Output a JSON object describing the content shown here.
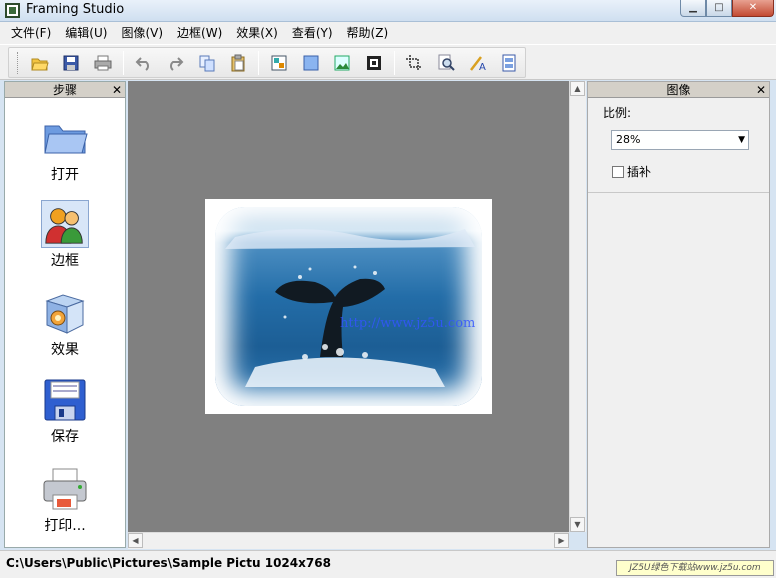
{
  "window": {
    "title": "Framing Studio"
  },
  "menu": [
    "文件(F)",
    "编辑(U)",
    "图像(V)",
    "边框(W)",
    "效果(X)",
    "查看(Y)",
    "帮助(Z)"
  ],
  "toolbar": {
    "icons": [
      "open-folder-icon",
      "save-icon",
      "print-icon",
      "undo-icon",
      "redo-icon",
      "copy-icon",
      "paste-icon",
      "image-adjust-icon",
      "frame-fill-icon",
      "picture-icon",
      "frame-border-icon",
      "crop-icon",
      "zoom-icon",
      "text-icon",
      "layout-icon"
    ]
  },
  "steps_panel": {
    "title": "步骤",
    "items": [
      {
        "label": "打开",
        "icon": "folder-icon"
      },
      {
        "label": "边框",
        "icon": "frame-people-icon"
      },
      {
        "label": "效果",
        "icon": "effects-box-icon"
      },
      {
        "label": "保存",
        "icon": "floppy-save-icon"
      },
      {
        "label": "打印...",
        "icon": "printer-icon"
      }
    ]
  },
  "canvas": {
    "watermark": "http://www.jz5u.com"
  },
  "image_panel": {
    "title": "图像",
    "scale_label": "比例:",
    "scale_value": "28%",
    "interpolate_label": "插补"
  },
  "status": {
    "text": "C:\\Users\\Public\\Pictures\\Sample Pictu  1024x768",
    "badge": "JZ5U绿色下载站www.jz5u.com"
  },
  "colors": {
    "canvas_bg": "#808080",
    "panel_header": "#d4d0c8"
  }
}
